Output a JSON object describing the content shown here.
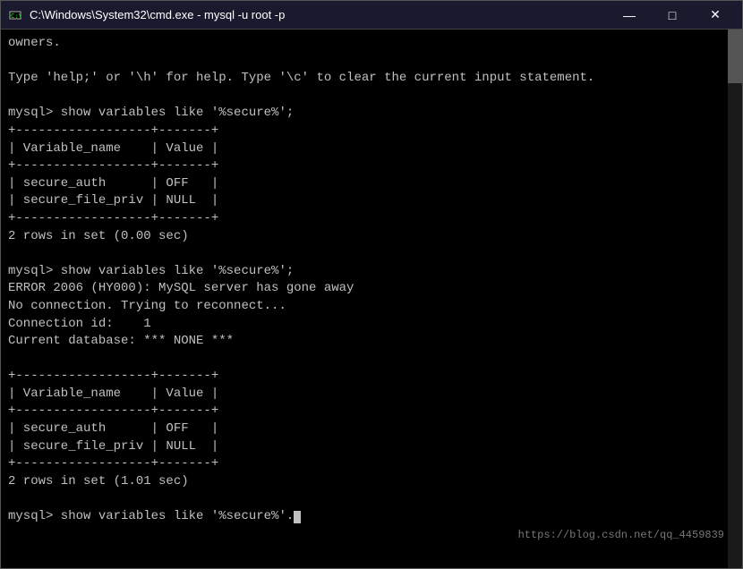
{
  "titlebar": {
    "title": "C:\\Windows\\System32\\cmd.exe - mysql  -u root -p",
    "minimize_label": "—",
    "maximize_label": "□",
    "close_label": "✕"
  },
  "terminal": {
    "lines": [
      "owners.",
      "",
      "Type 'help;' or '\\h' for help. Type '\\c' to clear the current input statement.",
      "",
      "mysql> show variables like '%secure%';",
      "+------------------+-------+",
      "| Variable_name    | Value |",
      "+------------------+-------+",
      "| secure_auth      | OFF   |",
      "| secure_file_priv | NULL  |",
      "+------------------+-------+",
      "2 rows in set (0.00 sec)",
      "",
      "mysql> show variables like '%secure%';",
      "ERROR 2006 (HY000): MySQL server has gone away",
      "No connection. Trying to reconnect...",
      "Connection id:    1",
      "Current database: *** NONE ***",
      "",
      "+------------------+-------+",
      "| Variable_name    | Value |",
      "+------------------+-------+",
      "| secure_auth      | OFF   |",
      "| secure_file_priv | NULL  |",
      "+------------------+-------+",
      "2 rows in set (1.01 sec)",
      "",
      "mysql> show variables like '%secure%'."
    ],
    "cursor_visible": true
  },
  "status_bar": {
    "url": "https://blog.csdn.net/qq_4459839"
  }
}
